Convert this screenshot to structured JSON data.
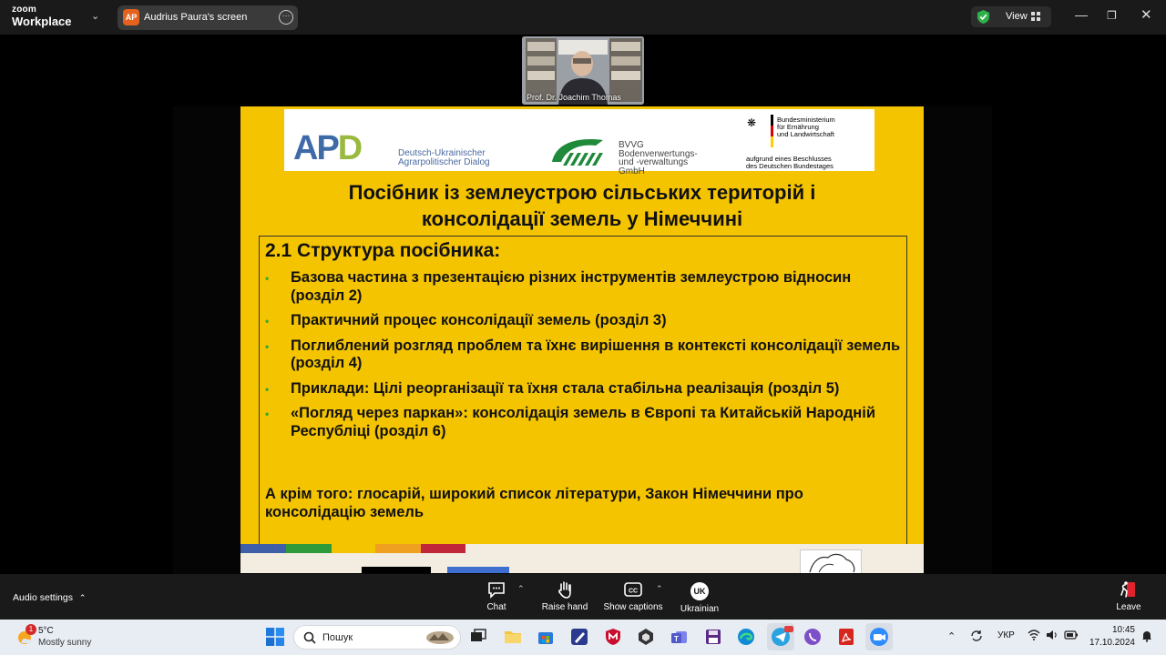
{
  "titlebar": {
    "brand_top": "zoom",
    "brand_bottom": "Workplace",
    "presenter_avatar": "AP",
    "share_title": "Audrius Paura's screen",
    "more_icon": "ellipsis-icon",
    "view_label": "View"
  },
  "video": {
    "participant_name": "Prof. Dr. Joachim Thomas"
  },
  "slide": {
    "logos": {
      "apd_mark_a": "AP",
      "apd_mark_d": "D",
      "apd_line1": "Deutsch-Ukrainischer",
      "apd_line2": "Agrarpolitischer Dialog",
      "bvvg_line1": "BVVG",
      "bvvg_line2": "Bodenverwertungs-",
      "bvvg_line3": "und -verwaltungs",
      "bvvg_line4": "GmbH",
      "bmel_line1": "Bundesministerium",
      "bmel_line2": "für Ernährung",
      "bmel_line3": "und Landwirtschaft",
      "bmel_sub1": "aufgrund eines Beschlusses",
      "bmel_sub2": "des Deutschen Bundestages"
    },
    "title_line1": "Посібник із землеустрою сільських територій і",
    "title_line2": "консолідації земель у Німеччині",
    "section_heading": "2.1 Структура посібника:",
    "bullets": [
      "Базова частина з презентацією різних інструментів землеустрою відносин (розділ 2)",
      "Практичний процес консолідації земель (розділ 3)",
      "Поглиблений розгляд проблем та їхнє вирішення в контексті консолідації земель (розділ 4)",
      "Приклади: Цілі реорганізації та їхня стала стабільна реалізація (розділ 5)",
      "«Погляд через паркан»: консолідація земель в Європі та Китайській Народній Республіці (розділ 6)"
    ],
    "extra_note": "А крім того: глосарій, широкий список літератури, Закон Німеччини про консолідацію земель",
    "colors": {
      "background": "#f5c400",
      "bullet": "#3aa635"
    }
  },
  "controls": {
    "audio_settings": "Audio settings",
    "chat": "Chat",
    "raise_hand": "Raise hand",
    "show_captions": "Show captions",
    "language_code": "UK",
    "language": "Ukrainian",
    "leave": "Leave"
  },
  "taskbar": {
    "weather_badge": "1",
    "temperature": "5°C",
    "condition": "Mostly sunny",
    "search_placeholder": "Пошук",
    "tray_language": "УКР",
    "time": "10:45",
    "date": "17.10.2024"
  }
}
